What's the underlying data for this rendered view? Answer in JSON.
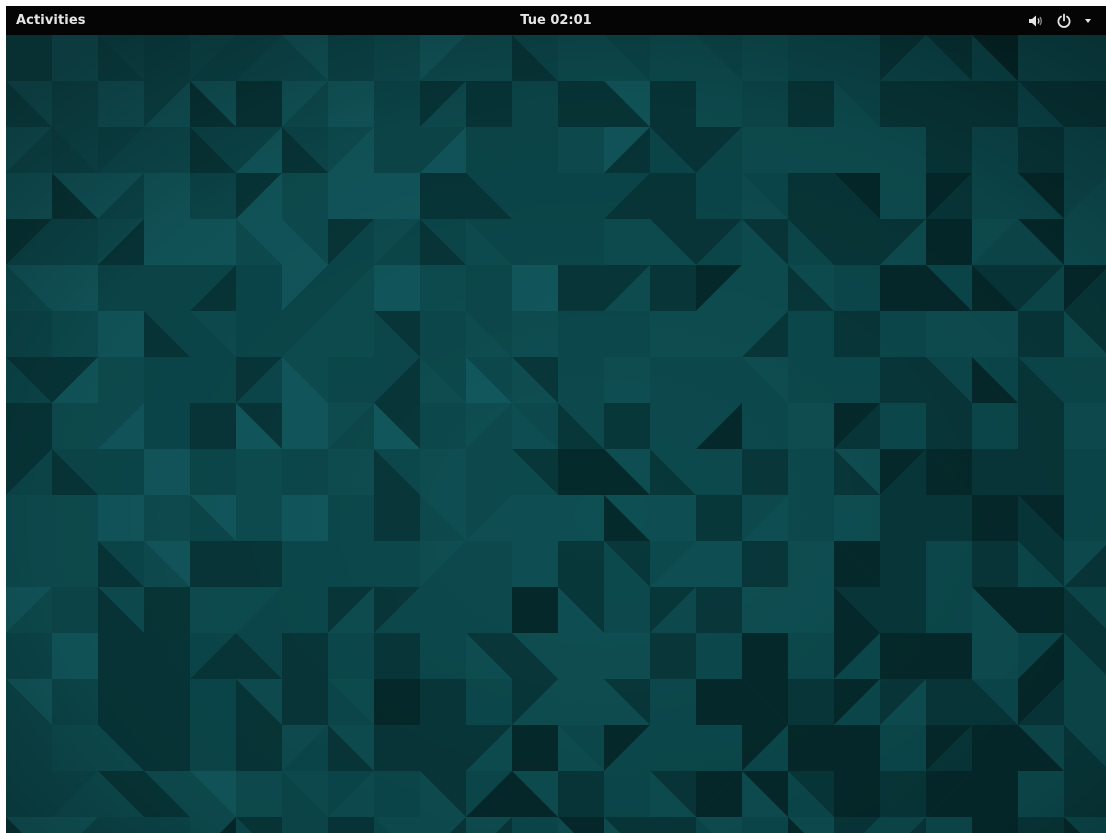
{
  "top_bar": {
    "activities_label": "Activities",
    "clock_text": "Tue 02:01",
    "status_icons": [
      "volume-icon",
      "power-icon",
      "dropdown-arrow-icon"
    ]
  },
  "wallpaper": {
    "description_colors": {
      "base": "#0c4a4e",
      "light": "#125a5f",
      "mid": "#0e4f53",
      "dark": "#08383b",
      "darkest": "#052a2c"
    }
  },
  "colors": {
    "panel_background": "#050505",
    "panel_text": "#e6e6e6"
  }
}
